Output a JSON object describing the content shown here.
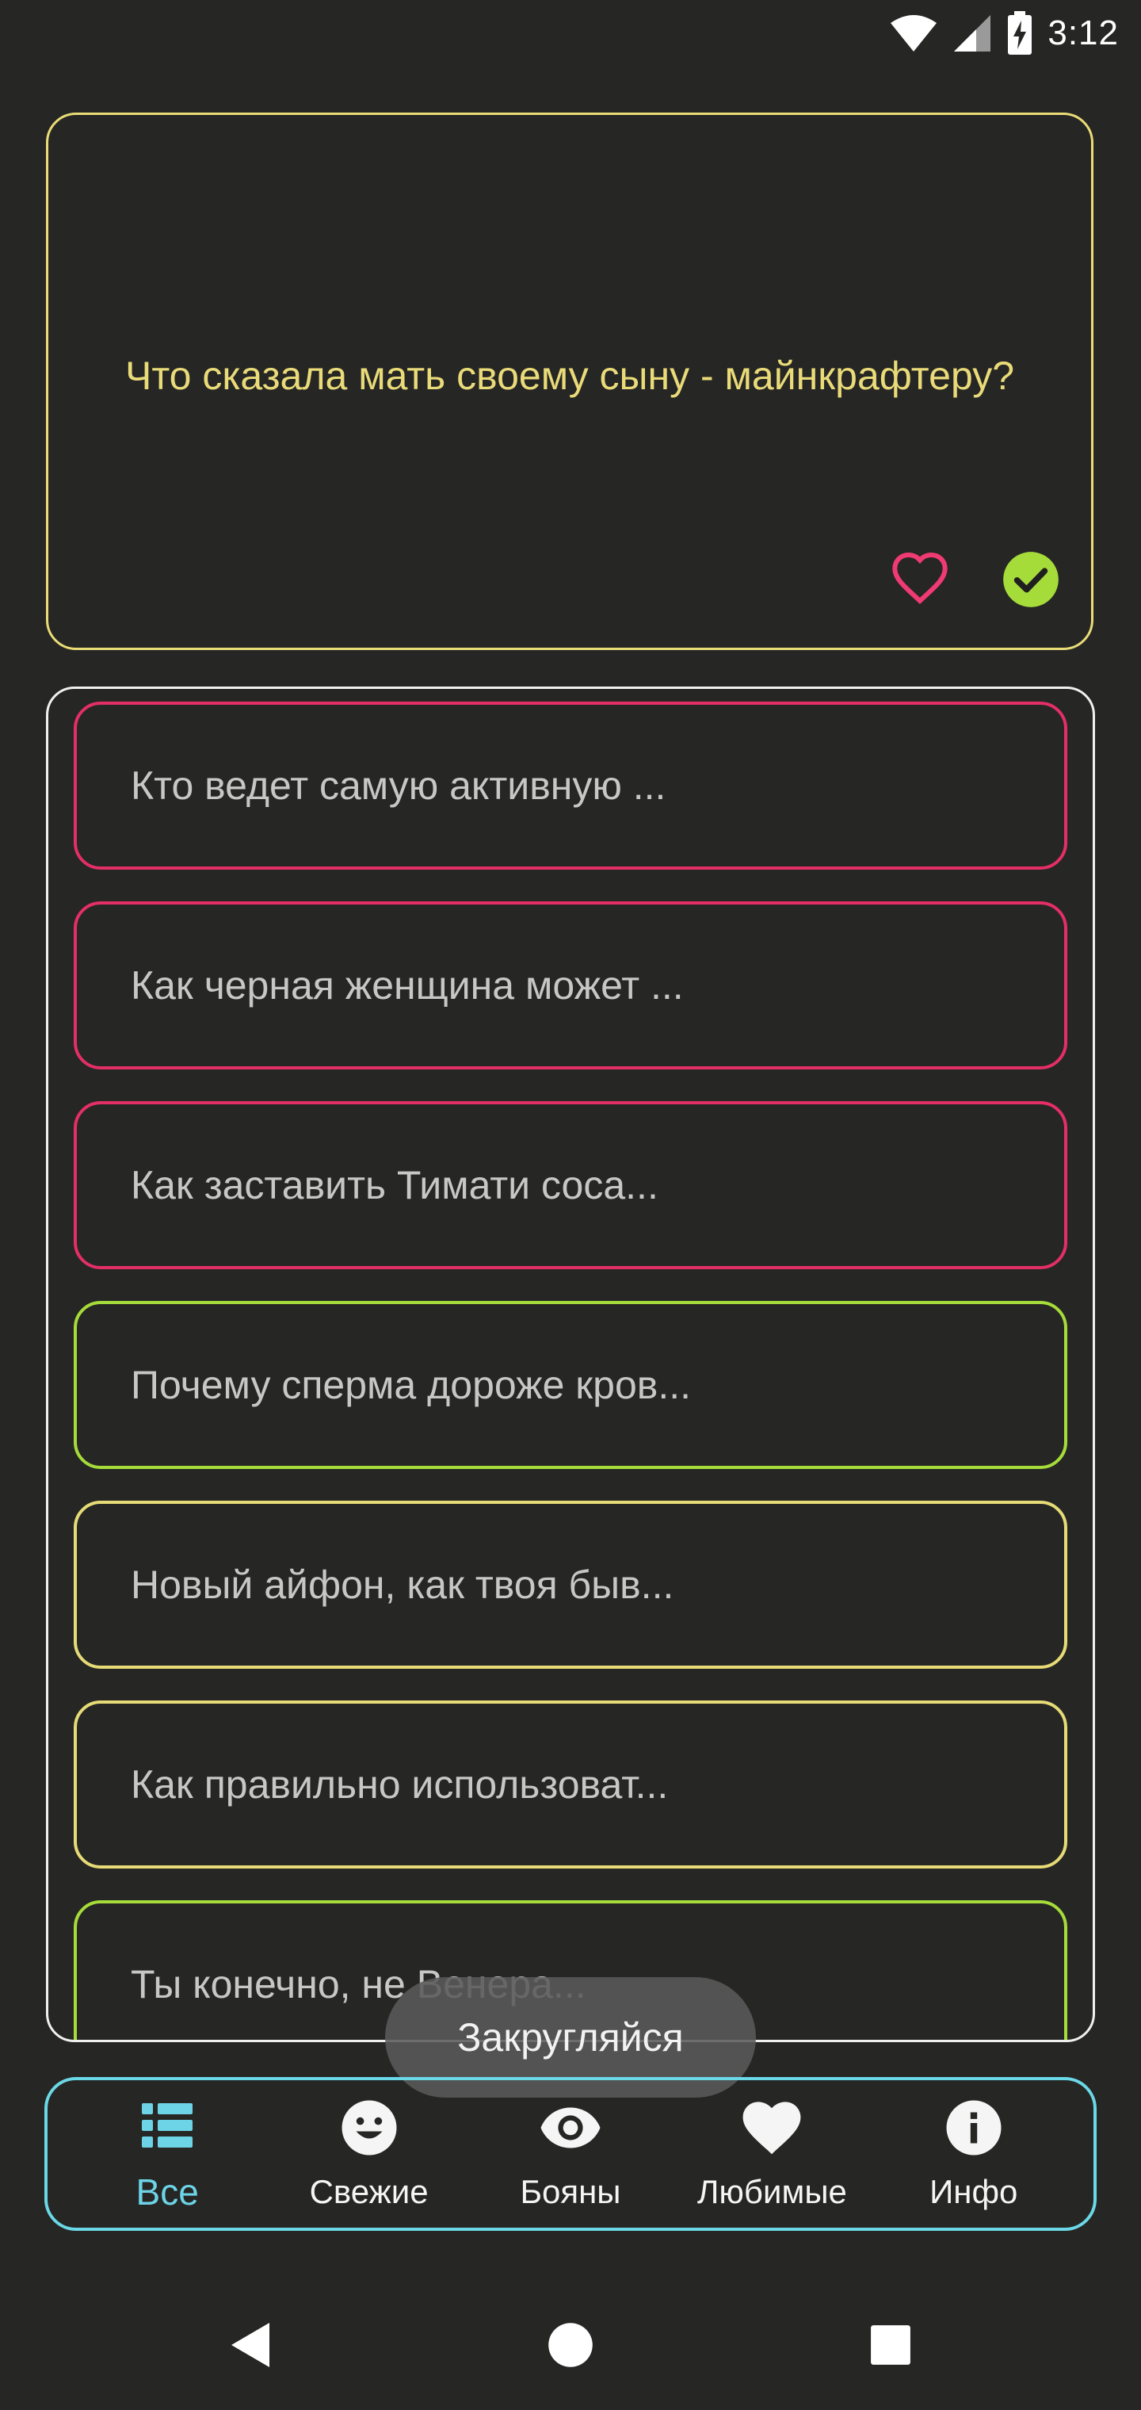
{
  "status_bar": {
    "time": "3:12",
    "icons": [
      "wifi-icon",
      "signal-icon",
      "battery-charging-icon"
    ]
  },
  "joke_card": {
    "question": "Что сказала мать своему сыну - майнкрафтеру?",
    "accent_color": "#e9dc77",
    "favorite_icon": "heart-outline-icon",
    "status_icon": "check-circle-icon"
  },
  "list": {
    "items": [
      {
        "text": "Кто ведет самую активную ...",
        "color": "pink"
      },
      {
        "text": "Как черная женщина может ...",
        "color": "pink"
      },
      {
        "text": "Как заставить Тимати соса...",
        "color": "pink"
      },
      {
        "text": "Почему сперма дороже кров...",
        "color": "green"
      },
      {
        "text": "Новый айфон, как твоя быв...",
        "color": "yellow"
      },
      {
        "text": "Как правильно использоват...",
        "color": "yellow"
      },
      {
        "text": "Ты конечно, не Венера...",
        "color": "green"
      }
    ]
  },
  "toast": {
    "text": "Закругляйся"
  },
  "bottom_nav": {
    "items": [
      {
        "label": "Все",
        "icon": "list-icon",
        "active": true
      },
      {
        "label": "Свежие",
        "icon": "smiley-icon",
        "active": false
      },
      {
        "label": "Бояны",
        "icon": "eye-icon",
        "active": false
      },
      {
        "label": "Любимые",
        "icon": "heart-icon",
        "active": false
      },
      {
        "label": "Инфо",
        "icon": "info-icon",
        "active": false
      }
    ],
    "accent_color": "#6ad8e6"
  },
  "colors": {
    "background": "#262624",
    "pink": "#e32f66",
    "green": "#a6dc3a",
    "yellow": "#e6db76"
  }
}
